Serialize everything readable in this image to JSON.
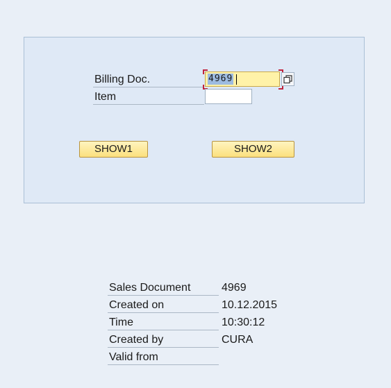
{
  "form": {
    "billing_doc_label": "Billing Doc.",
    "billing_doc_value": "4969",
    "item_label": "Item",
    "item_value": "",
    "show1_label": "SHOW1",
    "show2_label": "SHOW2"
  },
  "details": {
    "sales_document_label": "Sales Document",
    "sales_document_value": "4969",
    "created_on_label": "Created on",
    "created_on_value": "10.12.2015",
    "time_label": "Time",
    "time_value": "10:30:12",
    "created_by_label": "Created by",
    "created_by_value": "CURA",
    "valid_from_label": "Valid from",
    "valid_from_value": ""
  },
  "colors": {
    "background": "#e9eff7",
    "panel": "#dfe9f6",
    "button": "#fbe07e",
    "focused_field": "#fff2a8",
    "focus_corners": "#c0243c"
  },
  "icons": {
    "value_help": "value-help-icon"
  }
}
